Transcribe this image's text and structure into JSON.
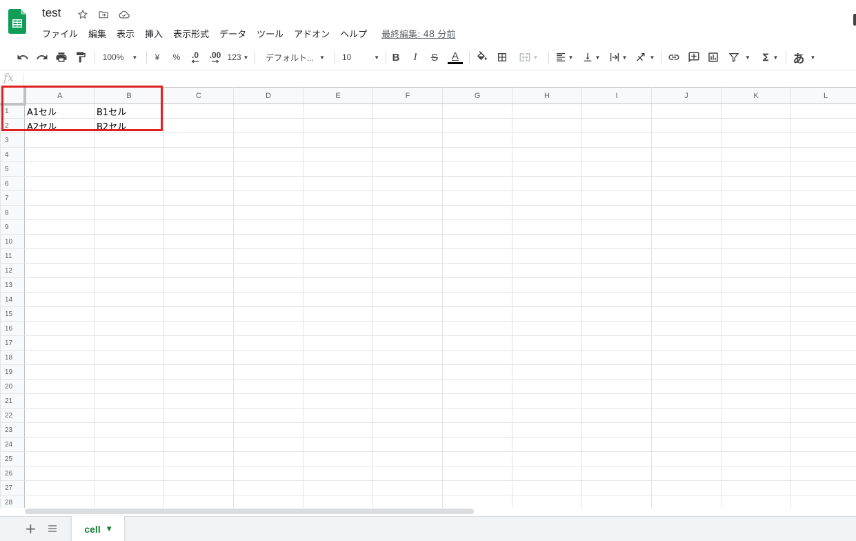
{
  "document": {
    "title": "test",
    "last_edit": "最終編集: 48 分前"
  },
  "menu": [
    "ファイル",
    "編集",
    "表示",
    "挿入",
    "表示形式",
    "データ",
    "ツール",
    "アドオン",
    "ヘルプ"
  ],
  "toolbar": {
    "zoom": "100%",
    "currency": "¥",
    "percent": "%",
    "decrease_decimal": ".0",
    "increase_decimal": ".00",
    "number_format": "123",
    "font": "デフォルト...",
    "font_size": "10",
    "bold": "B",
    "italic": "I",
    "strike": "S",
    "text_color": "A",
    "input_tools": "あ"
  },
  "formula_bar": {
    "fx": "fx"
  },
  "grid": {
    "columns": [
      "A",
      "B",
      "C",
      "D",
      "E",
      "F",
      "G",
      "H",
      "I",
      "J",
      "K",
      "L"
    ],
    "rows": [
      "1",
      "2",
      "3",
      "4",
      "5",
      "6",
      "7",
      "8",
      "9",
      "10",
      "11",
      "12",
      "13",
      "14",
      "15",
      "16",
      "17",
      "18",
      "19",
      "20",
      "21",
      "22",
      "23",
      "24",
      "25",
      "26",
      "27",
      "28"
    ],
    "cells": [
      [
        "A1セル",
        "B1セル"
      ],
      [
        "A2セル",
        "B2セル"
      ]
    ]
  },
  "sheets": {
    "tabs": [
      "cell"
    ]
  },
  "colors": {
    "brand_green": "#0f9d58",
    "sheet_tab": "#188038",
    "highlight_red": "#e02020"
  }
}
